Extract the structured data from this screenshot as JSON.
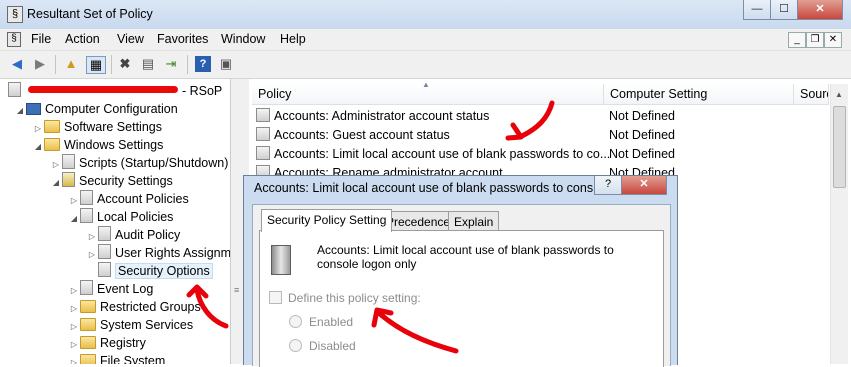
{
  "window": {
    "title": "Resultant Set of Policy",
    "controls": {
      "minimize": "—",
      "maximize": "☐",
      "close": "✕"
    }
  },
  "menubar": {
    "items": [
      "File",
      "Action",
      "View",
      "Favorites",
      "Window",
      "Help"
    ],
    "mdi_controls": {
      "minimize": "_",
      "restore": "❐",
      "close": "✕"
    }
  },
  "tree": {
    "root_suffix": "- RSoP",
    "items": [
      {
        "label": "Computer Configuration",
        "icon": "computer-icon"
      },
      {
        "label": "Software Settings",
        "icon": "folder-icon"
      },
      {
        "label": "Windows Settings",
        "icon": "folder-icon"
      },
      {
        "label": "Scripts (Startup/Shutdown)",
        "icon": "script-icon"
      },
      {
        "label": "Security Settings",
        "icon": "security-icon"
      },
      {
        "label": "Account Policies",
        "icon": "policy-icon"
      },
      {
        "label": "Local Policies",
        "icon": "policy-icon"
      },
      {
        "label": "Audit Policy",
        "icon": "policy-icon"
      },
      {
        "label": "User Rights Assignm",
        "icon": "policy-icon"
      },
      {
        "label": "Security Options",
        "icon": "policy-icon",
        "selected": true
      },
      {
        "label": "Event Log",
        "icon": "policy-icon"
      },
      {
        "label": "Restricted Groups",
        "icon": "folder-lock-icon"
      },
      {
        "label": "System Services",
        "icon": "folder-lock-icon"
      },
      {
        "label": "Registry",
        "icon": "folder-lock-icon"
      },
      {
        "label": "File System",
        "icon": "folder-lock-icon"
      }
    ]
  },
  "list": {
    "columns": [
      "Policy",
      "Computer Setting",
      "Sourc"
    ],
    "rows": [
      {
        "policy": "Accounts: Administrator account status",
        "setting": "Not Defined"
      },
      {
        "policy": "Accounts: Guest account status",
        "setting": "Not Defined"
      },
      {
        "policy": "Accounts: Limit local account use of blank passwords to co...",
        "setting": "Not Defined"
      },
      {
        "policy": "Accounts: Rename administrator account",
        "setting": "Not Defined"
      }
    ]
  },
  "dialog": {
    "title": "Accounts: Limit local account use of blank passwords to cons...",
    "help_button": "?",
    "close_button": "✕",
    "tabs": [
      "Security Policy Setting",
      "Precedence",
      "Explain"
    ],
    "description": "Accounts: Limit local account use of blank passwords to console logon only",
    "define_checkbox": "Define this policy setting:",
    "options": [
      "Enabled",
      "Disabled"
    ]
  },
  "colors": {
    "annotation": "#e8000a",
    "selection": "#e5f1fb",
    "close_button": "#c9463d"
  }
}
